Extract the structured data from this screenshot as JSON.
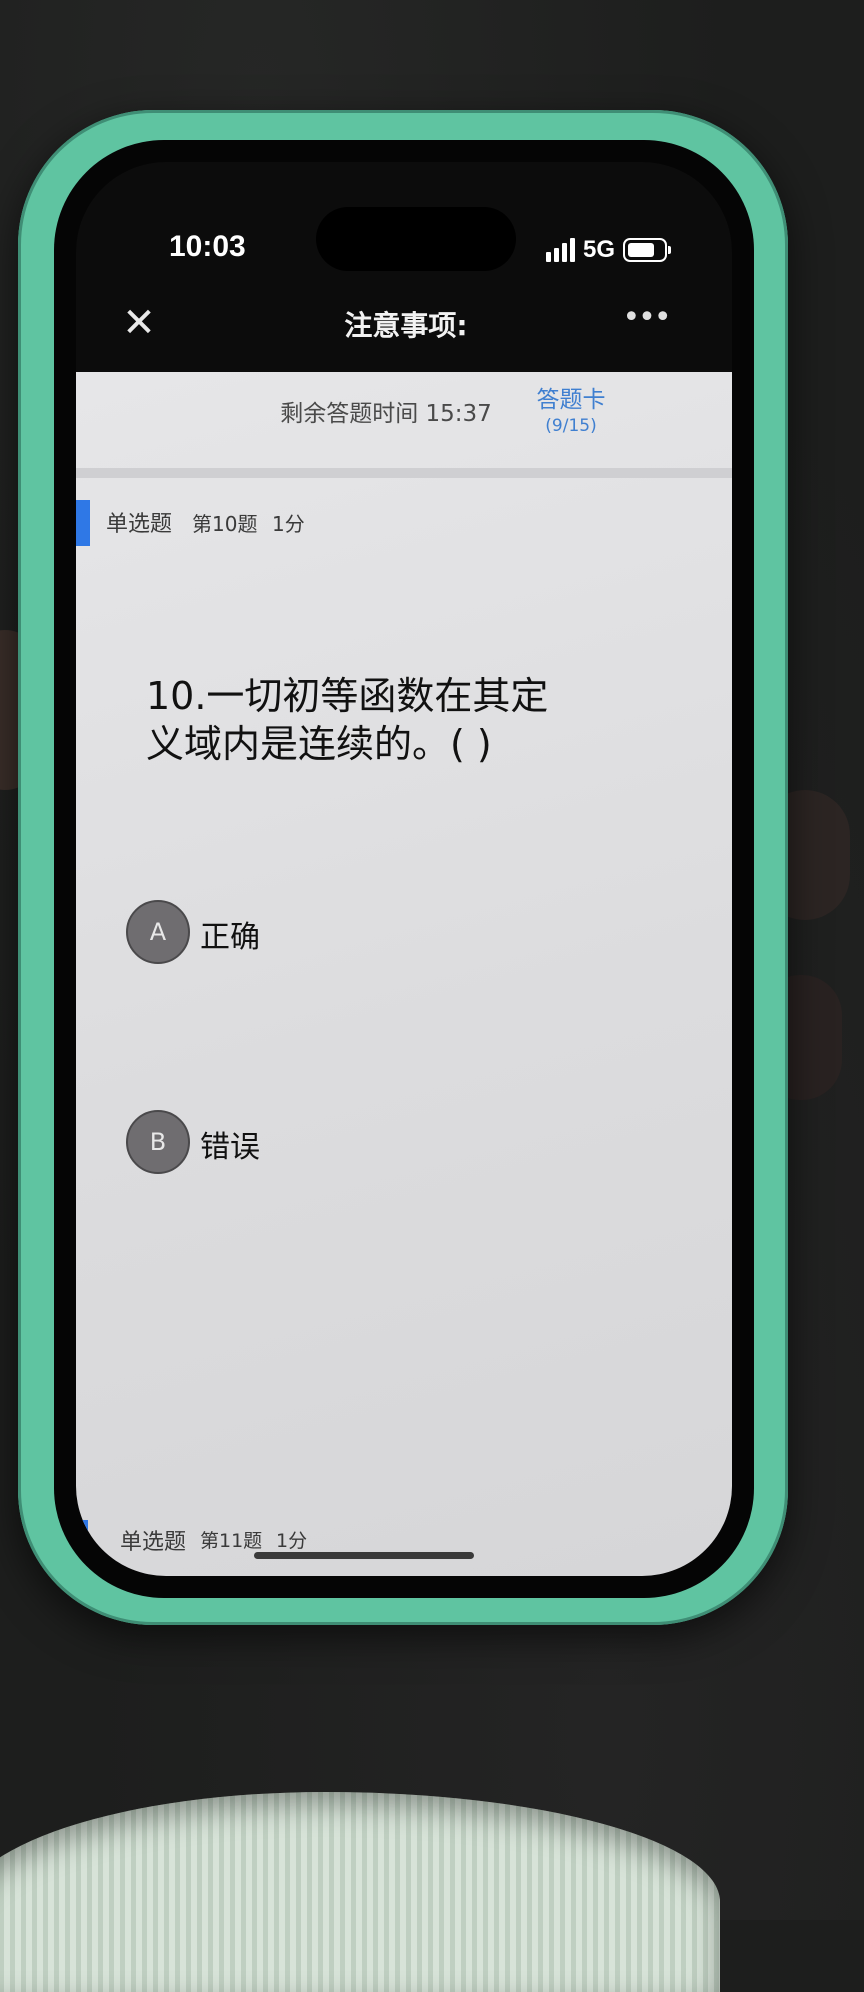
{
  "status_bar": {
    "time": "10:03",
    "network": "5G"
  },
  "nav": {
    "close_icon": "close-icon",
    "title": "注意事项:",
    "more_icon": "more-icon"
  },
  "exam": {
    "timer_text": "剩余答题时间 15:37",
    "answer_card": {
      "label": "答题卡",
      "progress": "(9/15)"
    }
  },
  "question": {
    "type": "单选题",
    "number_label": "第10题",
    "score_label": "1分",
    "text": "10.一切初等函数在其定义域内是连续的。( )",
    "options": [
      {
        "letter": "A",
        "text": "正确"
      },
      {
        "letter": "B",
        "text": "错误"
      }
    ]
  },
  "next_question": {
    "type": "单选题",
    "number_label": "第11题",
    "score_label": "1分"
  },
  "colors": {
    "accent": "#2f78e6",
    "link": "#3f7fd0",
    "case": "#5fc4a1"
  }
}
